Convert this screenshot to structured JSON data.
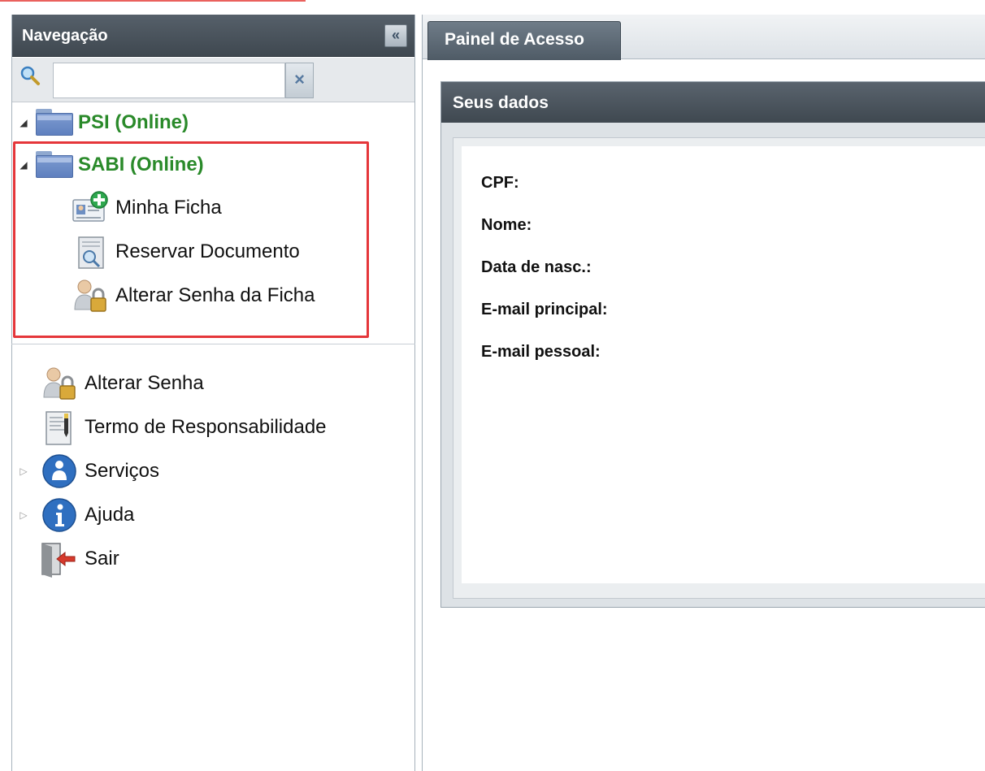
{
  "sidebar": {
    "title": "Navegação",
    "collapse_glyph": "«",
    "search": {
      "value": "",
      "placeholder": "",
      "clear_glyph": "×"
    },
    "tree": {
      "psi": {
        "label": "PSI (Online)"
      },
      "sabi": {
        "label": "SABI (Online)",
        "children": [
          {
            "label": "Minha Ficha",
            "icon": "id-card-add-icon"
          },
          {
            "label": "Reservar Documento",
            "icon": "document-search-icon"
          },
          {
            "label": "Alterar Senha da Ficha",
            "icon": "user-lock-icon"
          }
        ]
      }
    },
    "menu": [
      {
        "label": "Alterar Senha",
        "icon": "user-lock-icon"
      },
      {
        "label": "Termo de Responsabilidade",
        "icon": "document-pen-icon"
      },
      {
        "label": "Serviços",
        "icon": "user-circle-icon"
      },
      {
        "label": "Ajuda",
        "icon": "info-icon"
      },
      {
        "label": "Sair",
        "icon": "exit-icon"
      }
    ]
  },
  "main": {
    "tabs": [
      {
        "label": "Painel de Acesso",
        "active": true
      }
    ],
    "panel": {
      "title": "Seus dados",
      "fields": [
        {
          "label": "CPF:"
        },
        {
          "label": "Nome:"
        },
        {
          "label": "Data de nasc.:"
        },
        {
          "label": "E-mail principal:"
        },
        {
          "label": "E-mail pessoal:"
        }
      ]
    }
  },
  "colors": {
    "highlight": "#e5363a",
    "online_green": "#2a8a2a",
    "header_dark": "#3f4850"
  }
}
